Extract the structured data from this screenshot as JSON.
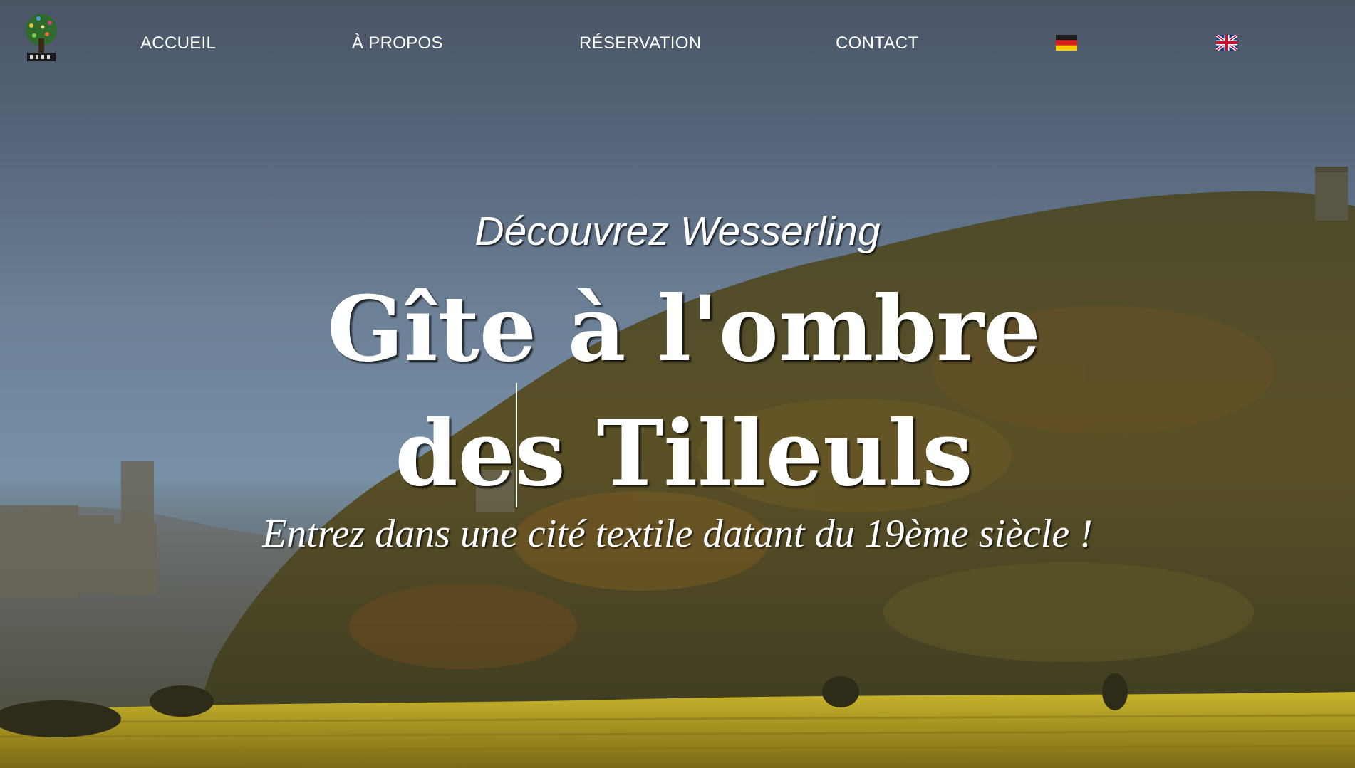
{
  "nav": {
    "items": [
      {
        "label": "ACCUEIL"
      },
      {
        "label": "À PROPOS"
      },
      {
        "label": "RÉSERVATION"
      },
      {
        "label": "CONTACT"
      }
    ],
    "languages": [
      "de-flag-icon",
      "en-flag-icon"
    ]
  },
  "hero": {
    "overline": "Découvrez Wesserling",
    "title": "Gîte à l'ombre des Tilleuls",
    "tagline": "Entrez dans une cité textile datant du 19ème siècle !"
  },
  "icons": {
    "logo": "tree-logo-icon"
  },
  "colors": {
    "text": "#ffffff",
    "sky": "#56657a",
    "forest": "#4a4a28",
    "vineyard": "#b8a020"
  }
}
